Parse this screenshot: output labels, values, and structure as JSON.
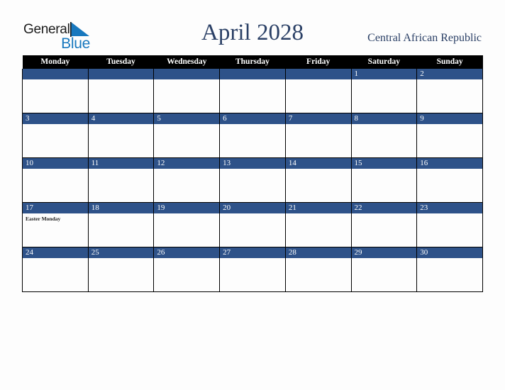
{
  "brand": {
    "name_part1": "General",
    "name_part2": "Blue",
    "accent_color": "#1878be",
    "triangle_icon": "triangle-icon"
  },
  "header": {
    "title": "April 2028",
    "country": "Central African Republic",
    "title_color": "#2b4066"
  },
  "calendar": {
    "accent_blue": "#2e5289",
    "header_bg": "#000000",
    "weekday_headers": [
      "Monday",
      "Tuesday",
      "Wednesday",
      "Thursday",
      "Friday",
      "Saturday",
      "Sunday"
    ],
    "weeks": [
      [
        {
          "date": "",
          "events": []
        },
        {
          "date": "",
          "events": []
        },
        {
          "date": "",
          "events": []
        },
        {
          "date": "",
          "events": []
        },
        {
          "date": "",
          "events": []
        },
        {
          "date": "1",
          "events": []
        },
        {
          "date": "2",
          "events": []
        }
      ],
      [
        {
          "date": "3",
          "events": []
        },
        {
          "date": "4",
          "events": []
        },
        {
          "date": "5",
          "events": []
        },
        {
          "date": "6",
          "events": []
        },
        {
          "date": "7",
          "events": []
        },
        {
          "date": "8",
          "events": []
        },
        {
          "date": "9",
          "events": []
        }
      ],
      [
        {
          "date": "10",
          "events": []
        },
        {
          "date": "11",
          "events": []
        },
        {
          "date": "12",
          "events": []
        },
        {
          "date": "13",
          "events": []
        },
        {
          "date": "14",
          "events": []
        },
        {
          "date": "15",
          "events": []
        },
        {
          "date": "16",
          "events": []
        }
      ],
      [
        {
          "date": "17",
          "events": [
            "Easter Monday"
          ]
        },
        {
          "date": "18",
          "events": []
        },
        {
          "date": "19",
          "events": []
        },
        {
          "date": "20",
          "events": []
        },
        {
          "date": "21",
          "events": []
        },
        {
          "date": "22",
          "events": []
        },
        {
          "date": "23",
          "events": []
        }
      ],
      [
        {
          "date": "24",
          "events": []
        },
        {
          "date": "25",
          "events": []
        },
        {
          "date": "26",
          "events": []
        },
        {
          "date": "27",
          "events": []
        },
        {
          "date": "28",
          "events": []
        },
        {
          "date": "29",
          "events": []
        },
        {
          "date": "30",
          "events": []
        }
      ]
    ]
  }
}
